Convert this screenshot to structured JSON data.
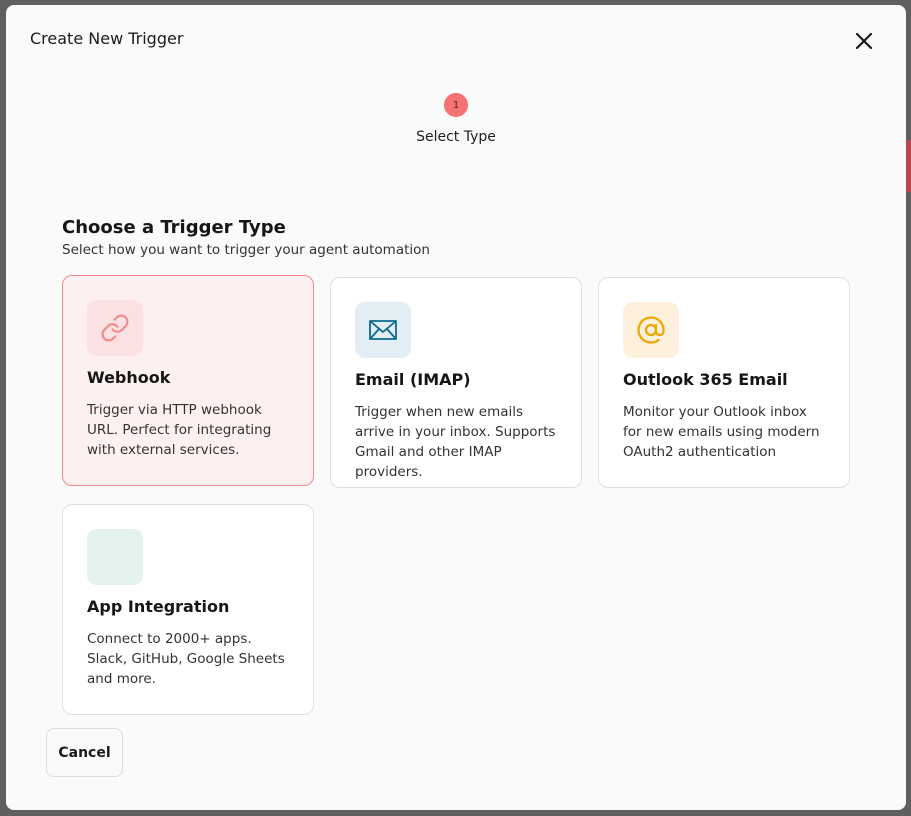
{
  "dialog": {
    "title": "Create New Trigger"
  },
  "stepper": {
    "steps": [
      {
        "number": "1",
        "label": "Select Type",
        "active": true
      }
    ]
  },
  "section": {
    "title": "Choose a Trigger Type",
    "subtitle": "Select how you want to trigger your agent automation"
  },
  "trigger_types": [
    {
      "name": "Webhook",
      "description": "Trigger via HTTP webhook URL. Perfect for integrating with external services.",
      "icon": "link-icon",
      "icon_color": "#f08a8c",
      "icon_bg": "#fbe1e1",
      "selected": true
    },
    {
      "name": "Email (IMAP)",
      "description": "Trigger when new emails arrive in your inbox. Supports Gmail and other IMAP providers.",
      "icon": "envelope-icon",
      "icon_color": "#0b6a8f",
      "icon_bg": "#e3eef4",
      "selected": false
    },
    {
      "name": "Outlook 365 Email",
      "description": "Monitor your Outlook inbox for new emails using modern OAuth2 authentication",
      "icon": "at-sign-icon",
      "icon_color": "#f0a500",
      "icon_bg": "#fdf1dd",
      "selected": false
    },
    {
      "name": "App Integration",
      "description": "Connect to 2000+ apps. Slack, GitHub, Google Sheets and more.",
      "icon": "app-integration-icon",
      "icon_color": "#c9e6dc",
      "icon_bg": "#e4f2ec",
      "selected": false
    }
  ],
  "footer": {
    "cancel_label": "Cancel"
  }
}
